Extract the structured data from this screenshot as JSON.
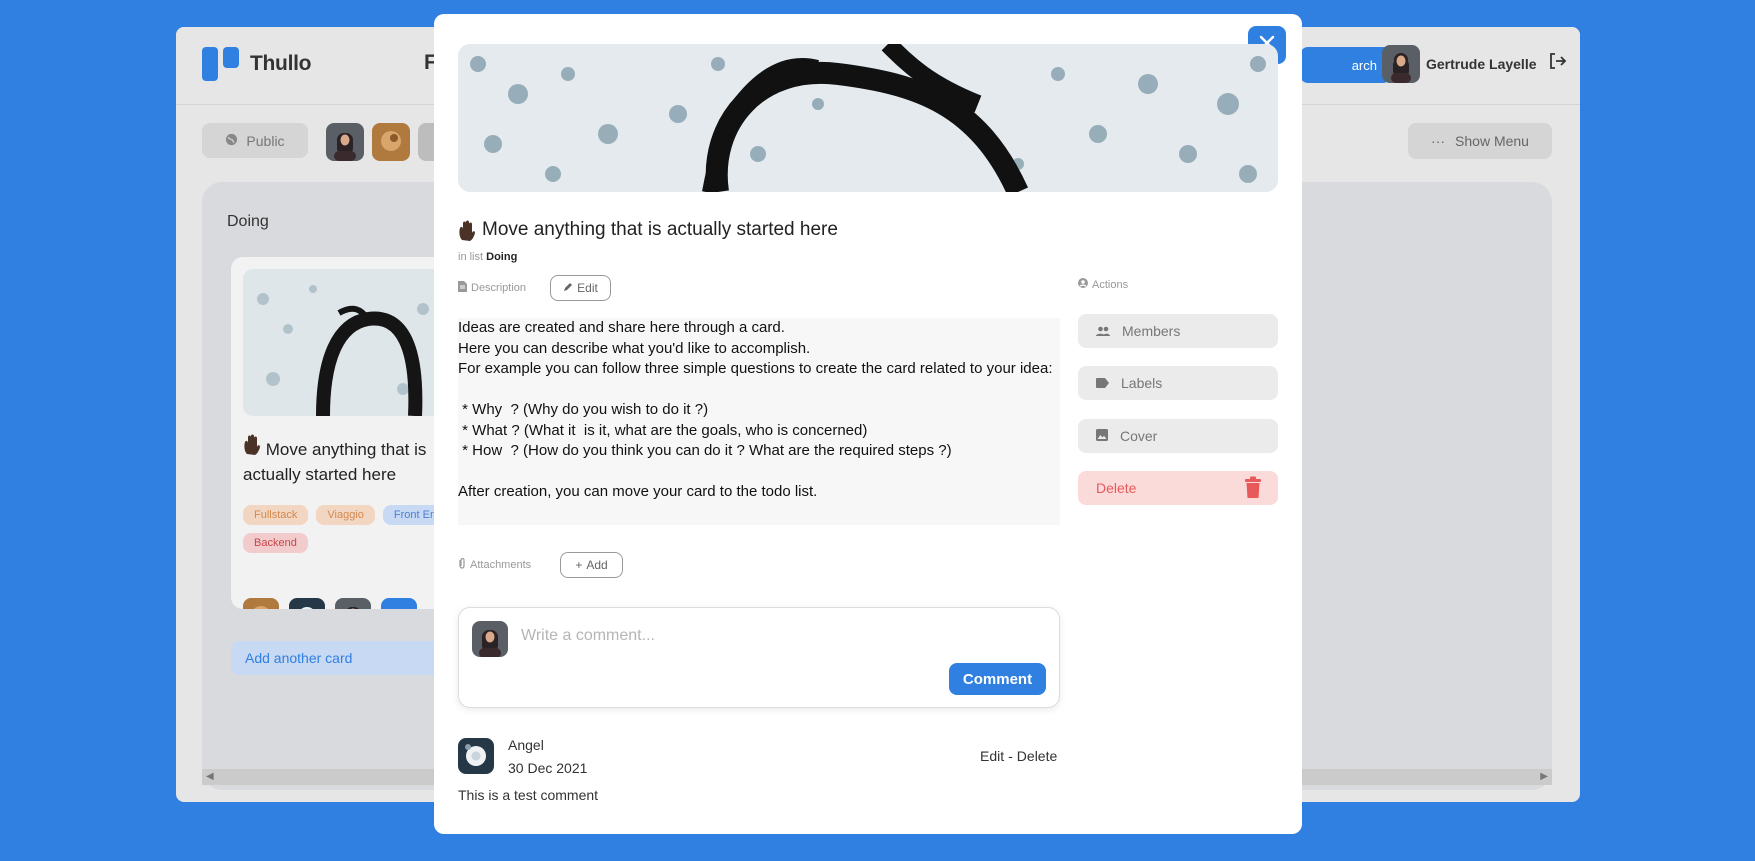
{
  "app": {
    "name": "Thullo",
    "board_name_partial": "F",
    "search_label": "arch",
    "user_name": "Gertrude Layelle",
    "visibility_label": "Public",
    "show_menu_label": "Show Menu"
  },
  "list": {
    "title": "Doing",
    "card": {
      "title": "Move anything that is actually started here",
      "tags": [
        {
          "label": "Fullstack",
          "color": "orange"
        },
        {
          "label": "Viaggio",
          "color": "orange"
        },
        {
          "label": "Front End",
          "color": "blue"
        },
        {
          "label": "Backend",
          "color": "red"
        }
      ],
      "add_member_label": "+"
    },
    "add_card_label": "Add another card"
  },
  "modal": {
    "title": "Move anything that is actually started here",
    "in_list_prefix": "in list",
    "in_list_name": "Doing",
    "description_label": "Description",
    "edit_label": "Edit",
    "description": "Ideas are created and share here through a card.\nHere you can describe what you'd like to accomplish.\nFor example you can follow three simple questions to create the card related to your idea:\n\n * Why  ? (Why do you wish to do it ?)\n * What ? (What it  is it, what are the goals, who is concerned)\n * How  ? (How do you think you can do it ? What are the required steps ?)\n\nAfter creation, you can move your card to the todo list.",
    "attachments_label": "Attachments",
    "add_label": "Add",
    "actions_label": "Actions",
    "actions": {
      "members": "Members",
      "labels": "Labels",
      "cover": "Cover",
      "delete": "Delete"
    },
    "comment_placeholder": "Write a comment...",
    "comment_button": "Comment",
    "comments": [
      {
        "author": "Angel",
        "date": "30 Dec 2021",
        "text": "This is a test comment",
        "edit": "Edit",
        "separator": "-",
        "delete": "Delete"
      }
    ]
  },
  "colors": {
    "accent": "#2f80e0",
    "danger": "#e85a5a",
    "danger_bg": "#fbdada"
  }
}
